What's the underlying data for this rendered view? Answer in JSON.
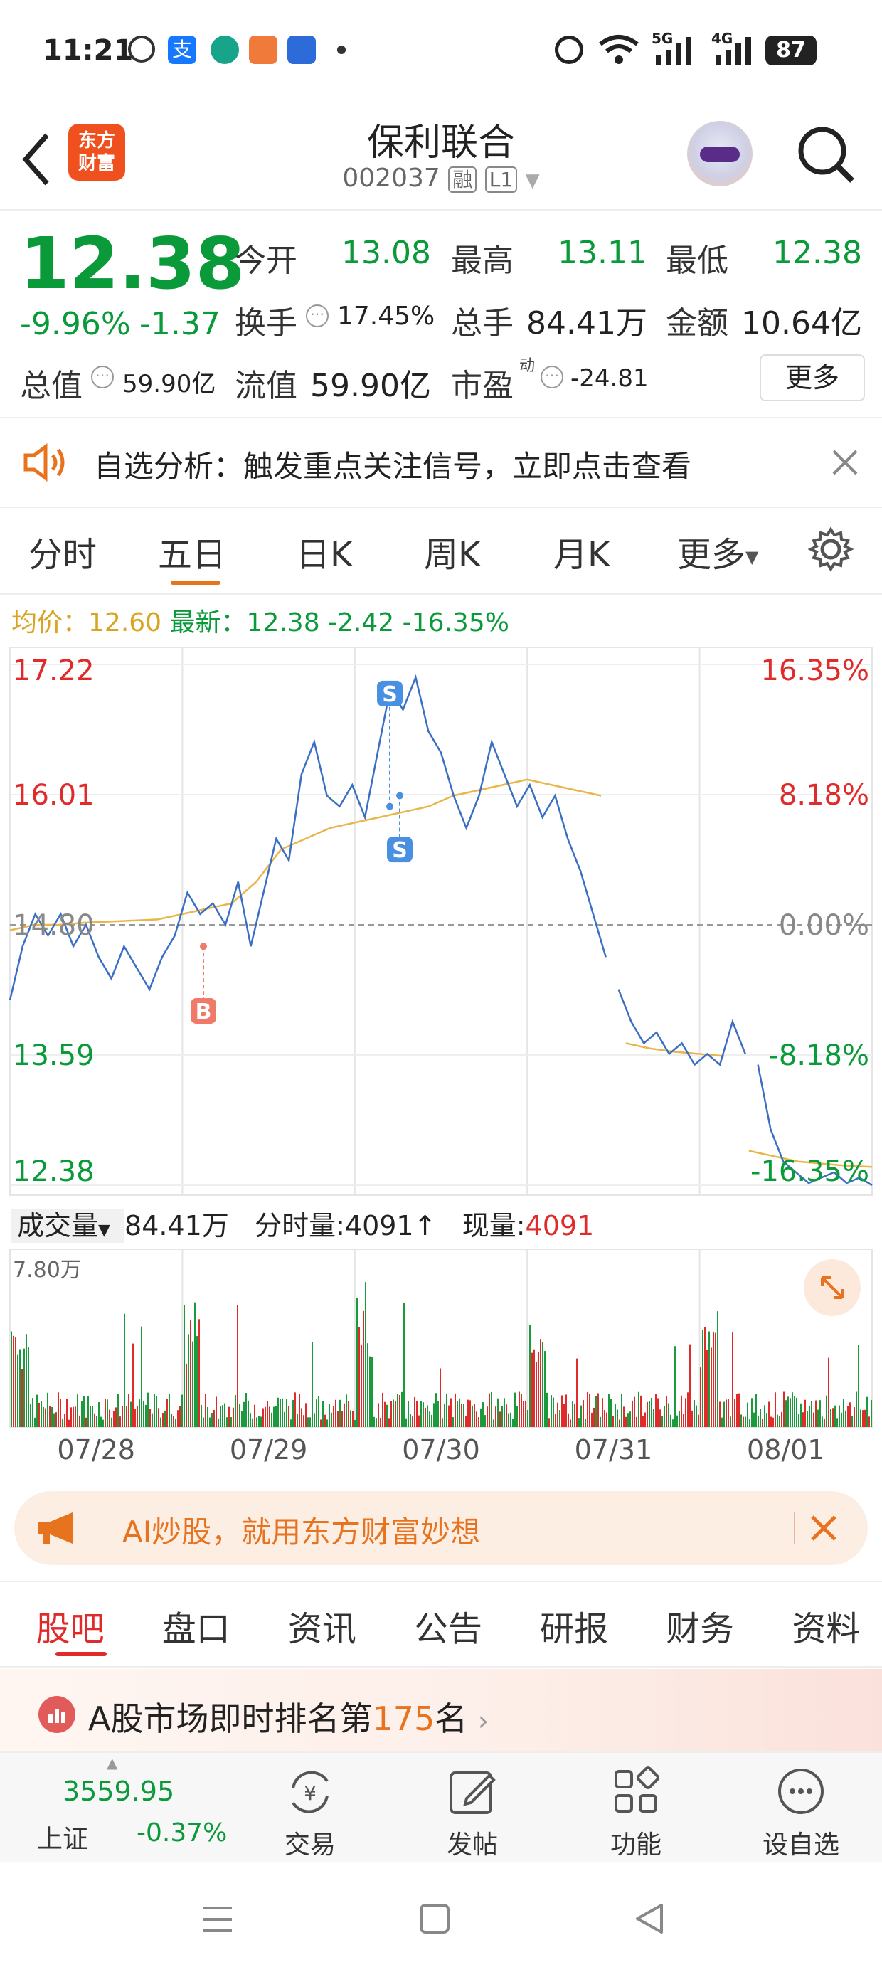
{
  "status": {
    "time": "11:21",
    "signal1": "5G",
    "signal2": "4G",
    "battery": "87"
  },
  "header": {
    "back_icon": "back-arrow",
    "logo": "东方\n财富",
    "title": "保利联合",
    "code": "002037",
    "tag_rong": "融",
    "tag_level": "L1"
  },
  "quote": {
    "price": "12.38",
    "change_pct": "-9.96%",
    "change": "-1.37",
    "open_label": "今开",
    "open": "13.08",
    "high_label": "最高",
    "high": "13.11",
    "low_label": "最低",
    "low": "12.38",
    "turnover_label": "换手",
    "turnover": "17.45%",
    "vol_label": "总手",
    "vol": "84.41万",
    "amount_label": "金额",
    "amount": "10.64亿",
    "mktcap_label": "总值",
    "mktcap": "59.90亿",
    "float_label": "流值",
    "float": "59.90亿",
    "pe_label": "市盈",
    "pe_sup": "动",
    "pe": "-24.81",
    "more_button": "更多"
  },
  "banner": {
    "text": "自选分析：触发重点关注信号，立即点击查看"
  },
  "chart_tabs": [
    "分时",
    "五日",
    "日K",
    "周K",
    "月K",
    "更多"
  ],
  "active_tab": "五日",
  "info_line": {
    "avg_label": "均价：",
    "avg": "12.60",
    "latest_label": "最新：",
    "latest": "12.38",
    "chg": "-2.42",
    "pct": "-16.35%"
  },
  "chart_data": {
    "type": "line",
    "title": "",
    "y_left_ticks": [
      "17.22",
      "16.01",
      "14.80",
      "13.59",
      "12.38"
    ],
    "y_right_ticks": [
      "16.35%",
      "8.18%",
      "0.00%",
      "-8.18%",
      "-16.35%"
    ],
    "ylim": [
      12.38,
      17.22
    ],
    "x_labels": [
      "07/28",
      "07/29",
      "07/30",
      "07/31",
      "08/01"
    ],
    "series": [
      {
        "name": "",
        "values": [
          14.1,
          14.6,
          14.9,
          14.7,
          14.9,
          14.6,
          14.8,
          14.5,
          14.3,
          14.6,
          14.4,
          14.2,
          14.5,
          14.7,
          15.1,
          14.9,
          15.0,
          14.8,
          15.2,
          14.6,
          15.1,
          15.6,
          15.4,
          16.2,
          16.5,
          16.0,
          15.9,
          16.1,
          15.8,
          16.4,
          17.0,
          16.8,
          17.1,
          16.6,
          16.4,
          16.0,
          15.7,
          16.0,
          16.5,
          16.2,
          15.9,
          16.1,
          15.8,
          16.0,
          15.6,
          15.3,
          14.9,
          14.5,
          14.2,
          13.9,
          13.7,
          13.8,
          13.6,
          13.7,
          13.5,
          13.6,
          13.5,
          13.9,
          13.6,
          13.5,
          12.9,
          12.6,
          12.5,
          12.4,
          12.45,
          12.5,
          12.4,
          12.45,
          12.38
        ]
      },
      {
        "name": "",
        "values": [
          14.75,
          14.8,
          14.8,
          14.82,
          14.83,
          14.84,
          14.85,
          14.9,
          14.95,
          15.0,
          15.2,
          15.5,
          15.6,
          15.7,
          15.75,
          15.8,
          15.85,
          15.9,
          16.0,
          16.05,
          16.1,
          16.15,
          16.1,
          16.05,
          16.0,
          13.7,
          13.65,
          13.62,
          13.6,
          13.58,
          12.7,
          12.65,
          12.6,
          12.58,
          12.56,
          12.55
        ]
      }
    ],
    "markers": [
      {
        "label": "B"
      },
      {
        "label": "S"
      },
      {
        "label": "S"
      }
    ]
  },
  "volume": {
    "selector": "成交量",
    "total": "84.41万",
    "tick_label": "分时量:",
    "tick_value": "4091",
    "now_label": "现量:",
    "now_value": "4091",
    "max_label": "7.80万"
  },
  "ad": {
    "text": "AI炒股，就用东方财富妙想"
  },
  "section_tabs": [
    "股吧",
    "盘口",
    "资讯",
    "公告",
    "研报",
    "财务",
    "资料"
  ],
  "rank": {
    "prefix": "A股市场即时排名第",
    "rank": "175",
    "suffix": "名"
  },
  "footer": {
    "index_value": "3559.95",
    "index_name": "上证",
    "index_change": "-0.37%",
    "items": [
      "交易",
      "发帖",
      "功能",
      "设自选"
    ]
  }
}
